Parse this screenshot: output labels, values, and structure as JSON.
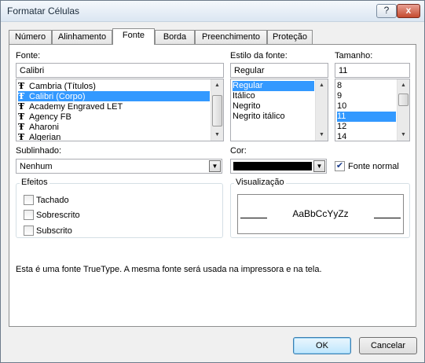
{
  "window": {
    "title": "Formatar Células",
    "help_label": "?",
    "close_label": "x"
  },
  "tabs": [
    {
      "label": "Número"
    },
    {
      "label": "Alinhamento"
    },
    {
      "label": "Fonte"
    },
    {
      "label": "Borda"
    },
    {
      "label": "Preenchimento"
    },
    {
      "label": "Proteção"
    }
  ],
  "active_tab": "Fonte",
  "font": {
    "label": "Fonte:",
    "value": "Calibri",
    "items": [
      "Cambria (Títulos)",
      "Calibri (Corpo)",
      "Academy Engraved LET",
      "Agency FB",
      "Aharoni",
      "Algerian"
    ],
    "selected": "Calibri (Corpo)",
    "item_icon": "truetype-icon"
  },
  "style": {
    "label": "Estilo da fonte:",
    "value": "Regular",
    "items": [
      "Regular",
      "Itálico",
      "Negrito",
      "Negrito itálico"
    ],
    "selected": "Regular"
  },
  "size": {
    "label": "Tamanho:",
    "value": "11",
    "items": [
      "8",
      "9",
      "10",
      "11",
      "12",
      "14"
    ],
    "selected": "11"
  },
  "underline": {
    "label": "Sublinhado:",
    "value": "Nenhum"
  },
  "color": {
    "label": "Cor:",
    "value_color": "#000000",
    "normal_font_label": "Fonte normal",
    "normal_font_checked": true
  },
  "effects": {
    "title": "Efeitos",
    "items": [
      {
        "label": "Tachado",
        "checked": false
      },
      {
        "label": "Sobrescrito",
        "checked": false
      },
      {
        "label": "Subscrito",
        "checked": false
      }
    ]
  },
  "preview": {
    "title": "Visualização",
    "sample": "AaBbCcYyZz"
  },
  "info_text": "Esta é uma fonte TrueType. A mesma fonte será usada na impressora e na tela.",
  "buttons": {
    "ok": "OK",
    "cancel": "Cancelar"
  },
  "colors": {
    "selection": "#3399ff",
    "dialog_bg": "#f0f0f0"
  }
}
